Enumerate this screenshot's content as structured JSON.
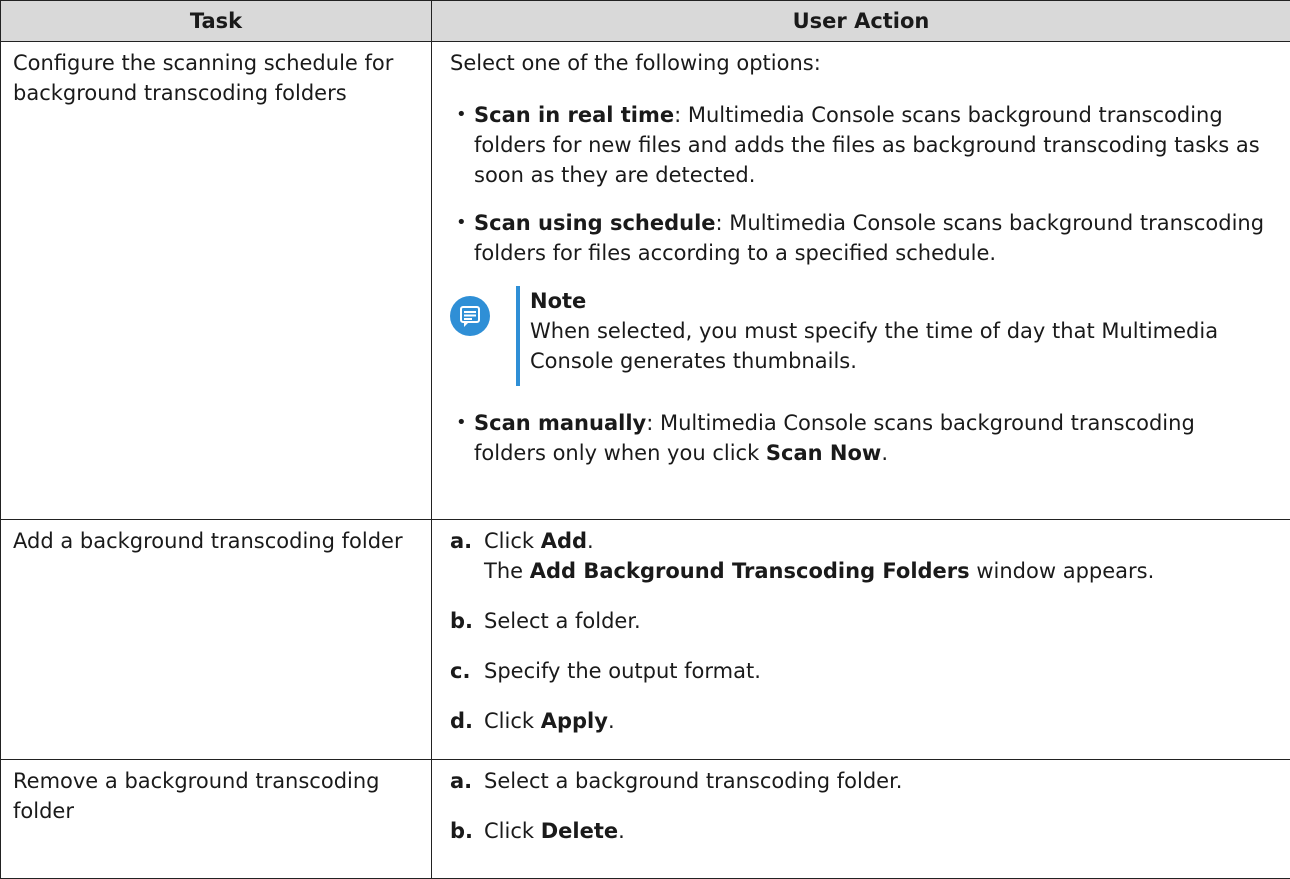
{
  "headers": {
    "task": "Task",
    "action": "User Action"
  },
  "row1": {
    "task": "Configure the scanning schedule for background transcoding folders",
    "intro": "Select one of the following options:",
    "options": [
      {
        "title": "Scan in real time",
        "text": ": Multimedia Console scans background transcoding folders for new files and adds the files as background transcoding tasks as soon as they are detected."
      },
      {
        "title": "Scan using schedule",
        "text": ": Multimedia Console scans background transcoding folders for files according to a specified schedule."
      }
    ],
    "note": {
      "icon": "note-icon",
      "title": "Note",
      "text": "When selected, you must specify the time of day that Multimedia Console generates thumbnails."
    },
    "last_option": {
      "title": "Scan manually",
      "text_before": ": Multimedia Console scans background transcoding folders only when you click ",
      "bold": "Scan Now",
      "text_after": "."
    }
  },
  "row2": {
    "task": "Add a background transcoding folder",
    "steps": {
      "a": {
        "label": "a.",
        "pre": "Click ",
        "bold": "Add",
        "post": ".",
        "sub_pre": "The ",
        "sub_bold": "Add Background Transcoding Folders",
        "sub_post": " window appears."
      },
      "b": {
        "label": "b.",
        "text": "Select a folder."
      },
      "c": {
        "label": "c.",
        "text": "Specify the output format."
      },
      "d": {
        "label": "d.",
        "pre": "Click ",
        "bold": "Apply",
        "post": "."
      }
    }
  },
  "row3": {
    "task": "Remove a background transcoding folder",
    "steps": {
      "a": {
        "label": "a.",
        "text": "Select a background transcoding folder."
      },
      "b": {
        "label": "b.",
        "pre": "Click ",
        "bold": "Delete",
        "post": "."
      }
    }
  },
  "colors": {
    "header_bg": "#d9d9d9",
    "note_accent": "#2f8fd6",
    "border": "#222222"
  }
}
